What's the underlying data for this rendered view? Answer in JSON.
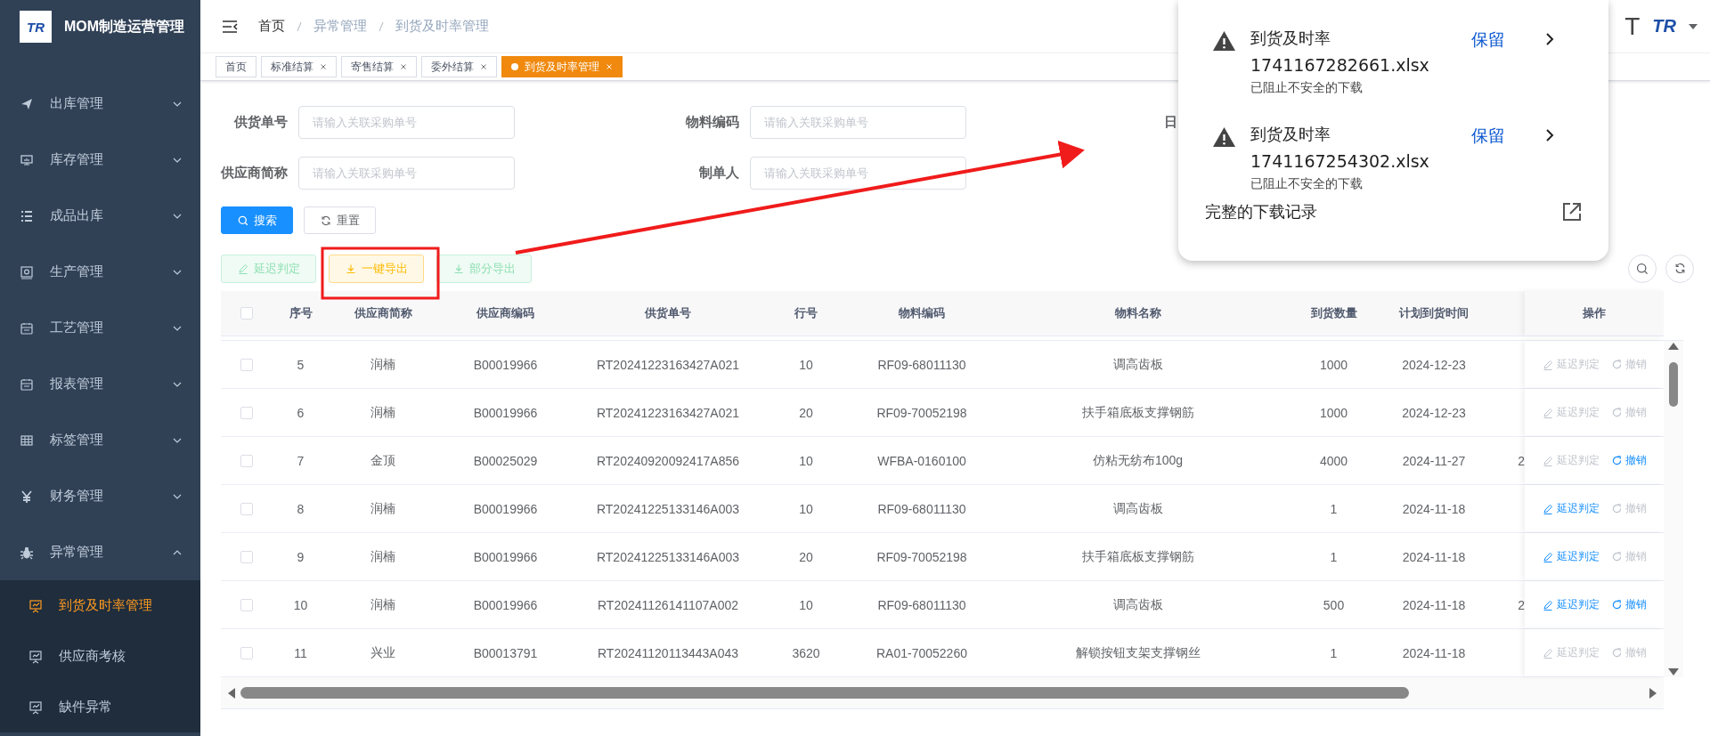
{
  "sidebar": {
    "logo": "TR",
    "title": "MOM制造运营管理",
    "items": [
      {
        "label": "出库管理",
        "expanded": false
      },
      {
        "label": "库存管理",
        "expanded": false
      },
      {
        "label": "成品出库",
        "expanded": false
      },
      {
        "label": "生产管理",
        "expanded": false
      },
      {
        "label": "工艺管理",
        "expanded": false
      },
      {
        "label": "报表管理",
        "expanded": false
      },
      {
        "label": "标签管理",
        "expanded": false
      },
      {
        "label": "财务管理",
        "expanded": false
      },
      {
        "label": "异常管理",
        "expanded": true,
        "children": [
          {
            "label": "到货及时率管理",
            "selected": true
          },
          {
            "label": "供应商考核",
            "selected": false
          },
          {
            "label": "缺件异常",
            "selected": false
          }
        ]
      }
    ]
  },
  "header": {
    "breadcrumb": [
      "首页",
      "异常管理",
      "到货及时率管理"
    ],
    "user_text": "T",
    "logo": "TR"
  },
  "tags": [
    {
      "label": "首页",
      "selected": false,
      "closable": false
    },
    {
      "label": "标准结算",
      "selected": false,
      "closable": true
    },
    {
      "label": "寄售结算",
      "selected": false,
      "closable": true
    },
    {
      "label": "委外结算",
      "selected": false,
      "closable": true
    },
    {
      "label": "到货及时率管理",
      "selected": true,
      "closable": true
    }
  ],
  "filters": [
    {
      "label": "供货单号",
      "placeholder": "请输入关联采购单号"
    },
    {
      "label": "物料编码",
      "placeholder": "请输入关联采购单号"
    },
    {
      "label": "日"
    },
    {
      "label": "供应商简称",
      "placeholder": "请输入关联采购单号"
    },
    {
      "label": "制单人",
      "placeholder": "请输入关联采购单号"
    }
  ],
  "search_buttons": [
    {
      "label": "搜索",
      "kind": "primary"
    },
    {
      "label": "重置",
      "kind": "default"
    }
  ],
  "toolbar": [
    {
      "label": "延迟判定",
      "kind": "success",
      "disabled": true
    },
    {
      "label": "一键导出",
      "kind": "warning",
      "disabled": false
    },
    {
      "label": "部分导出",
      "kind": "success",
      "disabled": true
    }
  ],
  "table": {
    "all_selected": false,
    "columns": [
      "序号",
      "供应商简称",
      "供应商编码",
      "供货单号",
      "行号",
      "物料编码",
      "物料名称",
      "到货数量",
      "计划到货时间",
      "操作"
    ],
    "rows": [
      {
        "selected": false,
        "cells": [
          "5",
          "润楠",
          "B00019966",
          "RT20241223163427A021",
          "10",
          "RF09-68011130",
          "调高齿板",
          "1000",
          "2024-12-23"
        ],
        "actions": [
          {
            "kind": "delay",
            "label": "延迟判定",
            "disabled": true
          },
          {
            "kind": "revoke",
            "label": "撤销",
            "disabled": true
          }
        ]
      },
      {
        "selected": false,
        "cells": [
          "6",
          "润楠",
          "B00019966",
          "RT20241223163427A021",
          "20",
          "RF09-70052198",
          "扶手箱底板支撑钢筋",
          "1000",
          "2024-12-23"
        ],
        "actions": [
          {
            "kind": "delay",
            "label": "延迟判定",
            "disabled": true
          },
          {
            "kind": "revoke",
            "label": "撤销",
            "disabled": true
          }
        ]
      },
      {
        "selected": false,
        "cells": [
          "7",
          "金顶",
          "B00025029",
          "RT20240920092417A856",
          "10",
          "WFBA-0160100",
          "仿粘无纺布100g",
          "4000",
          "2024-11-27"
        ],
        "column_11": "2",
        "actions": [
          {
            "kind": "delay",
            "label": "延迟判定",
            "disabled": true
          },
          {
            "kind": "revoke",
            "label": "撤销",
            "disabled": false
          }
        ]
      },
      {
        "selected": false,
        "cells": [
          "8",
          "润楠",
          "B00019966",
          "RT20241225133146A003",
          "10",
          "RF09-68011130",
          "调高齿板",
          "1",
          "2024-11-18"
        ],
        "actions": [
          {
            "kind": "delay",
            "label": "延迟判定",
            "disabled": false
          },
          {
            "kind": "revoke",
            "label": "撤销",
            "disabled": true
          }
        ]
      },
      {
        "selected": false,
        "cells": [
          "9",
          "润楠",
          "B00019966",
          "RT20241225133146A003",
          "20",
          "RF09-70052198",
          "扶手箱底板支撑钢筋",
          "1",
          "2024-11-18"
        ],
        "actions": [
          {
            "kind": "delay",
            "label": "延迟判定",
            "disabled": false
          },
          {
            "kind": "revoke",
            "label": "撤销",
            "disabled": true
          }
        ]
      },
      {
        "selected": false,
        "cells": [
          "10",
          "润楠",
          "B00019966",
          "RT20241126141107A002",
          "10",
          "RF09-68011130",
          "调高齿板",
          "500",
          "2024-11-18"
        ],
        "column_11": "2",
        "actions": [
          {
            "kind": "delay",
            "label": "延迟判定",
            "disabled": false
          },
          {
            "kind": "revoke",
            "label": "撤销",
            "disabled": false
          }
        ]
      },
      {
        "selected": false,
        "cells": [
          "11",
          "兴业",
          "B00013791",
          "RT20241120113443A043",
          "3620",
          "RA01-70052260",
          "解锁按钮支架支撑钢丝",
          "1",
          "2024-11-18"
        ],
        "actions": [
          {
            "kind": "delay",
            "label": "延迟判定",
            "disabled": true
          },
          {
            "kind": "revoke",
            "label": "撤销",
            "disabled": true
          }
        ]
      }
    ]
  },
  "downloads": {
    "items": [
      {
        "name": "到货及时率",
        "file": "1741167282661.xlsx",
        "status": "已阻止不安全的下载",
        "action": "保留"
      },
      {
        "name": "到货及时率",
        "file": "1741167254302.xlsx",
        "status": "已阻止不安全的下载",
        "action": "保留"
      }
    ],
    "footer": "完整的下载记录"
  }
}
